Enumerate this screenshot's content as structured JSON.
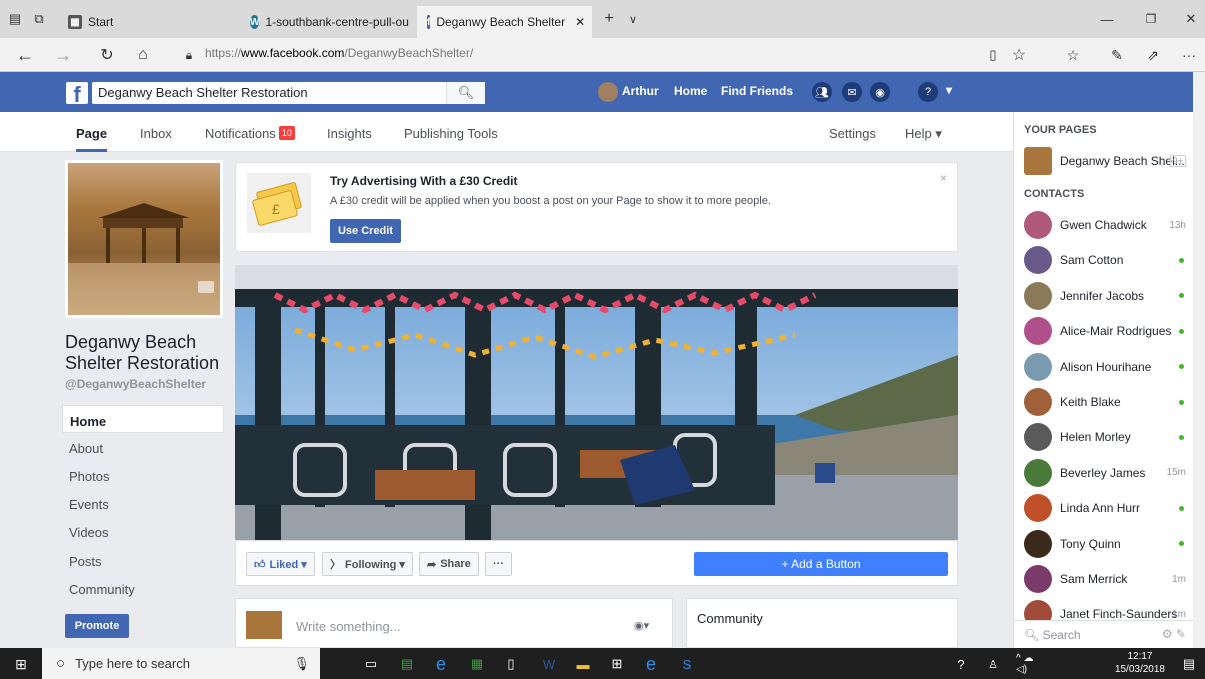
{
  "browser": {
    "tabs": [
      {
        "label": "Start"
      },
      {
        "label": "1-southbank-centre-pull-ou"
      },
      {
        "label": "Deganwy Beach Shelter"
      }
    ],
    "url_prefix": "https://",
    "url_host": "www.facebook.com",
    "url_path": "/DeganwyBeachShelter/"
  },
  "fb": {
    "search_value": "Deganwy Beach Shelter Restoration",
    "user": "Arthur",
    "nav_home": "Home",
    "nav_find_friends": "Find Friends"
  },
  "page_nav": {
    "page": "Page",
    "inbox": "Inbox",
    "notifications": "Notifications",
    "notif_count": "10",
    "insights": "Insights",
    "publishing_tools": "Publishing Tools",
    "settings": "Settings",
    "help": "Help ▾"
  },
  "page": {
    "name": "Deganwy Beach Shelter Restoration",
    "handle": "@DeganwyBeachShelter",
    "nav": [
      "Home",
      "About",
      "Photos",
      "Events",
      "Videos",
      "Posts",
      "Community"
    ],
    "promote": "Promote"
  },
  "ad": {
    "title": "Try Advertising With a £30 Credit",
    "text": "A £30 credit will be applied when you boost a post on your Page to show it to more people.",
    "button": "Use Credit",
    "close": "×"
  },
  "actions": {
    "liked": "Liked ▾",
    "following": "Following ▾",
    "share": "Share",
    "more": "···",
    "add_button": "+ Add a Button"
  },
  "composer": {
    "placeholder": "Write something..."
  },
  "community_title": "Community",
  "sidebar": {
    "your_pages": "YOUR PAGES",
    "page_short": "Deganwy Beach Shel...",
    "page_badge": "9+",
    "contacts_title": "CONTACTS",
    "contacts": [
      {
        "name": "Gwen Chadwick",
        "status": "13h",
        "online": false,
        "color": "#b05a7a"
      },
      {
        "name": "Sam Cotton",
        "status": "",
        "online": true,
        "color": "#6a5a8a"
      },
      {
        "name": "Jennifer Jacobs",
        "status": "",
        "online": true,
        "color": "#8a7a5a"
      },
      {
        "name": "Alice-Mair Rodrigues",
        "status": "",
        "online": true,
        "color": "#b0508a"
      },
      {
        "name": "Alison Hourihane",
        "status": "",
        "online": true,
        "color": "#7a9ab0"
      },
      {
        "name": "Keith Blake",
        "status": "",
        "online": true,
        "color": "#a0603a"
      },
      {
        "name": "Helen Morley",
        "status": "",
        "online": true,
        "color": "#5a5a5a"
      },
      {
        "name": "Beverley James",
        "status": "15m",
        "online": false,
        "color": "#4a7a3a"
      },
      {
        "name": "Linda Ann Hurr",
        "status": "",
        "online": true,
        "color": "#c0502a"
      },
      {
        "name": "Tony Quinn",
        "status": "",
        "online": true,
        "color": "#3a2a1a"
      },
      {
        "name": "Sam Merrick",
        "status": "1m",
        "online": false,
        "color": "#7a3a6a"
      },
      {
        "name": "Janet Finch-Saunders",
        "status": "1m",
        "online": false,
        "color": "#a04a3a"
      }
    ],
    "search_placeholder": "Search"
  },
  "taskbar": {
    "search": "Type here to search",
    "time": "12:17",
    "date": "15/03/2018"
  }
}
